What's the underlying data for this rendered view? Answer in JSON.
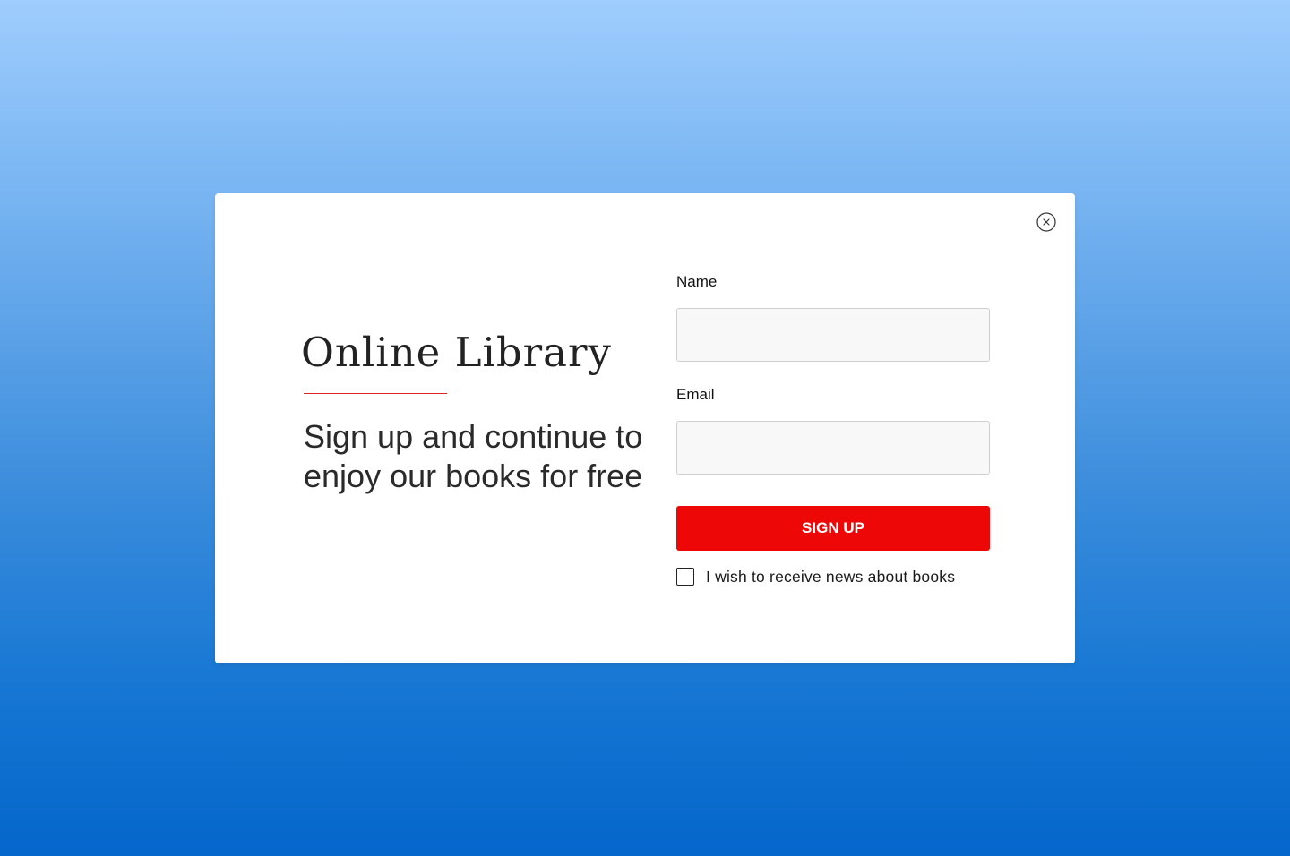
{
  "modal": {
    "close_icon": "close-circle-icon",
    "title": "Online Library",
    "tagline": "Sign up and continue to enjoy our books for free",
    "accent_color": "#ee0707"
  },
  "form": {
    "name_label": "Name",
    "name_value": "",
    "email_label": "Email",
    "email_value": "",
    "submit_label": "SIGN UP",
    "checkbox_checked": false,
    "checkbox_label": "I wish to receive news about books"
  }
}
